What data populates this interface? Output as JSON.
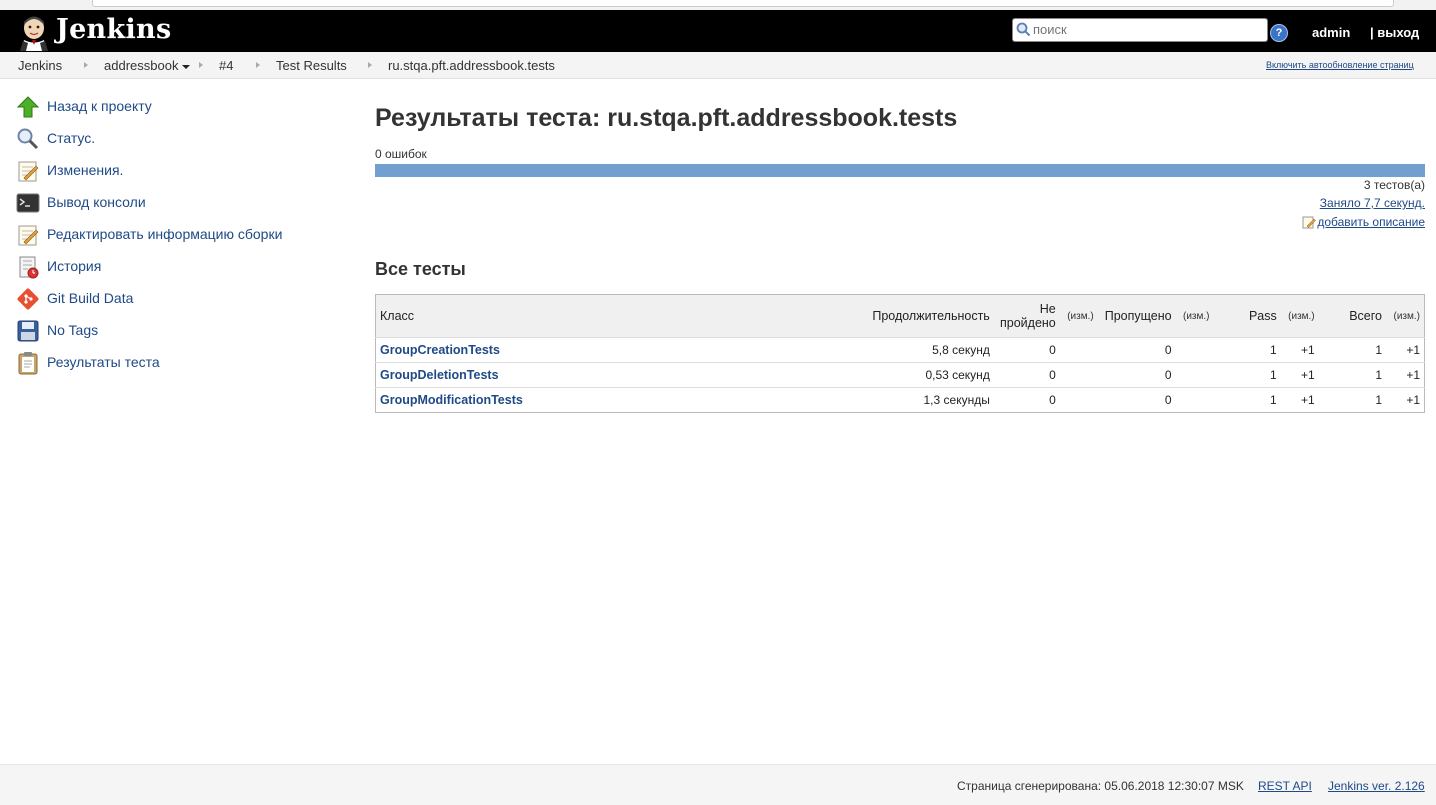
{
  "header": {
    "brand": "Jenkins",
    "search_placeholder": "поиск",
    "help_label": "?",
    "user": "admin",
    "logout": "| выход"
  },
  "breadcrumbs": {
    "items": [
      "Jenkins",
      "addressbook",
      "#4",
      "Test Results",
      "ru.stqa.pft.addressbook.tests"
    ],
    "autorefresh": "Включить автообновление страниц"
  },
  "sidebar": {
    "items": [
      {
        "label": "Назад к проекту",
        "icon": "up-arrow-icon"
      },
      {
        "label": "Статус.",
        "icon": "magnifier-icon"
      },
      {
        "label": "Изменения.",
        "icon": "notepad-icon"
      },
      {
        "label": "Вывод консоли",
        "icon": "terminal-icon"
      },
      {
        "label": "Редактировать информацию сборки",
        "icon": "notepad-edit-icon"
      },
      {
        "label": "История",
        "icon": "history-icon"
      },
      {
        "label": "Git Build Data",
        "icon": "git-icon"
      },
      {
        "label": "No Tags",
        "icon": "floppy-disk-icon"
      },
      {
        "label": "Результаты теста",
        "icon": "clipboard-icon"
      }
    ]
  },
  "main": {
    "title": "Результаты теста: ru.stqa.pft.addressbook.tests",
    "failures": "0 ошибок",
    "fail_fraction": 0,
    "test_count": "3 тестов(а)",
    "duration": "Заняло 7,7 секунд.",
    "add_description": "добавить описание",
    "section_title": "Все тесты"
  },
  "table": {
    "headers": {
      "class": "Класс",
      "duration": "Продолжительность",
      "failed_line1": "Не",
      "failed_line2": "пройдено",
      "diff": "(изм.)",
      "skipped": "Пропущено",
      "pass": "Pass",
      "total": "Всего"
    },
    "rows": [
      {
        "class": "GroupCreationTests",
        "duration": "5,8 секунд",
        "failed": "0",
        "skipped": "0",
        "pass": "1",
        "pass_diff": "+1",
        "total": "1",
        "total_diff": "+1"
      },
      {
        "class": "GroupDeletionTests",
        "duration": "0,53 секунд",
        "failed": "0",
        "skipped": "0",
        "pass": "1",
        "pass_diff": "+1",
        "total": "1",
        "total_diff": "+1"
      },
      {
        "class": "GroupModificationTests",
        "duration": "1,3 секунды",
        "failed": "0",
        "skipped": "0",
        "pass": "1",
        "pass_diff": "+1",
        "total": "1",
        "total_diff": "+1"
      }
    ]
  },
  "footer": {
    "generated": "Страница сгенерирована: 05.06.2018 12:30:07 MSK",
    "rest_api": "REST API",
    "version": "Jenkins ver. 2.126"
  },
  "colors": {
    "header_bg": "#000000",
    "link": "#204A87",
    "progress_pass": "#729fcf"
  }
}
